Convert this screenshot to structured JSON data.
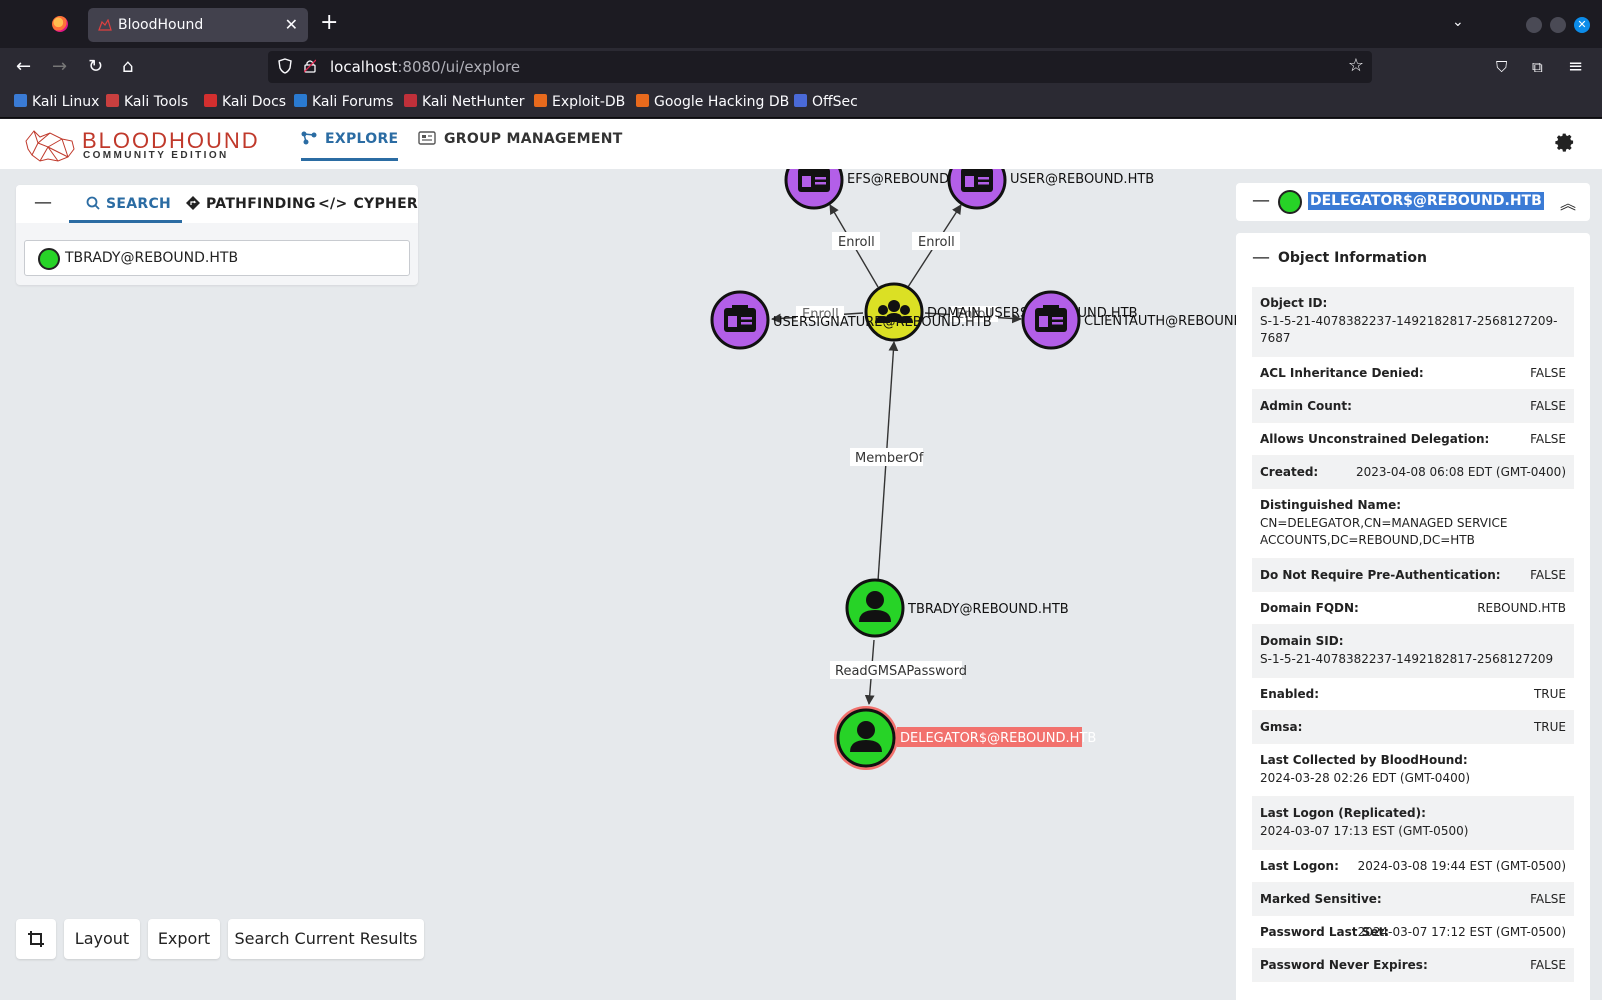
{
  "browser": {
    "tab_title": "BloodHound",
    "tab_close": "✕",
    "new_tab": "+",
    "url_host": "localhost",
    "url_path": ":8080/ui/explore",
    "bookmarks": [
      "Kali Linux",
      "Kali Tools",
      "Kali Docs",
      "Kali Forums",
      "Kali NetHunter",
      "Exploit-DB",
      "Google Hacking DB",
      "OffSec"
    ]
  },
  "app": {
    "logo_title": "BLOODHOUND",
    "logo_subtitle": "COMMUNITY EDITION",
    "nav": {
      "explore": "EXPLORE",
      "group_management": "GROUP MANAGEMENT"
    }
  },
  "left_panel": {
    "collapse": "—",
    "tabs": {
      "search": "SEARCH",
      "pathfinding": "PATHFINDING",
      "cypher": "CYPHER"
    },
    "search_value": "TBRADY@REBOUND.HTB"
  },
  "graph": {
    "nodes": {
      "efs": "EFS@REBOUND.HTB",
      "user": "USER@REBOUND.HTB",
      "usersignature": "USERSIGNATURE@REBOUND.HTB",
      "domain_users": "DOMAIN USERS@REBOUND.HTB",
      "clientauth": "CLIENTAUTH@REBOUND.HTB",
      "tbrady": "TBRADY@REBOUND.HTB",
      "delegator": "DELEGATOR$@REBOUND.HTB"
    },
    "edges": {
      "enroll": "Enroll",
      "memberof": "MemberOf",
      "readgmsa": "ReadGMSAPassword"
    },
    "colors": {
      "group": "#dbe024",
      "user": "#27d327",
      "template": "#b35fe8",
      "selected_ring": "#f2716d"
    }
  },
  "bottom_bar": {
    "layout": "Layout",
    "export": "Export",
    "search_current": "Search Current Results"
  },
  "right_panel": {
    "collapse": "—",
    "title": "DELEGATOR$@REBOUND.HTB",
    "chevron": "⌃",
    "section_title": "Object Information",
    "rows": [
      {
        "key": "Object ID:",
        "value": "S-1-5-21-4078382237-1492182817-2568127209-7687",
        "block": true
      },
      {
        "key": "ACL Inheritance Denied:",
        "value": "FALSE"
      },
      {
        "key": "Admin Count:",
        "value": "FALSE"
      },
      {
        "key": "Allows Unconstrained Delegation:",
        "value": "FALSE"
      },
      {
        "key": "Created:",
        "value": "2023-04-08 06:08 EDT (GMT-0400)"
      },
      {
        "key": "Distinguished Name:",
        "value": "CN=DELEGATOR,CN=MANAGED SERVICE ACCOUNTS,DC=REBOUND,DC=HTB",
        "block": true
      },
      {
        "key": "Do Not Require Pre-Authentication:",
        "value": "FALSE"
      },
      {
        "key": "Domain FQDN:",
        "value": "REBOUND.HTB"
      },
      {
        "key": "Domain SID:",
        "value": "S-1-5-21-4078382237-1492182817-2568127209",
        "block": true
      },
      {
        "key": "Enabled:",
        "value": "TRUE"
      },
      {
        "key": "Gmsa:",
        "value": "TRUE"
      },
      {
        "key": "Last Collected by BloodHound:",
        "value": "2024-03-28 02:26 EDT (GMT-0400)",
        "block": true
      },
      {
        "key": "Last Logon (Replicated):",
        "value": "2024-03-07 17:13 EST (GMT-0500)",
        "block": true
      },
      {
        "key": "Last Logon:",
        "value": "2024-03-08 19:44 EST (GMT-0500)"
      },
      {
        "key": "Marked Sensitive:",
        "value": "FALSE"
      },
      {
        "key": "Password Last Set:",
        "value": "2024-03-07 17:12 EST (GMT-0500)"
      },
      {
        "key": "Password Never Expires:",
        "value": "FALSE"
      }
    ]
  }
}
